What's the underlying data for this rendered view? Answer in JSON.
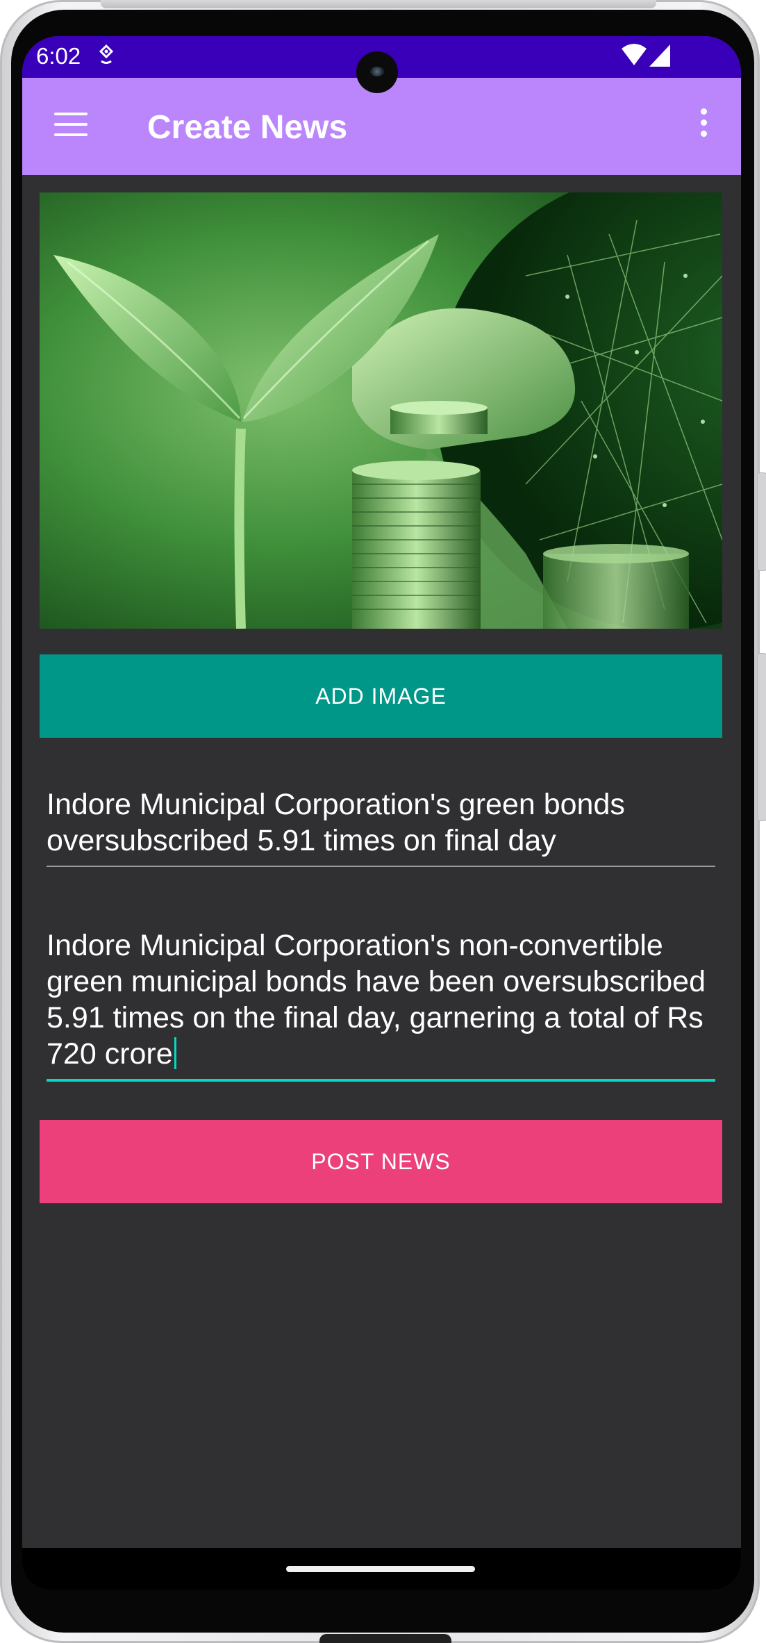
{
  "status_bar": {
    "time": "6:02",
    "background_color": "#3a00b9",
    "left_icons": [
      "location-icon"
    ],
    "right_icons": [
      "wifi-icon",
      "cell-signal-icon"
    ]
  },
  "app_bar": {
    "title": "Create News",
    "background_color": "#bb86fc",
    "left_icon": "menu-icon",
    "right_icon": "overflow-menu-icon"
  },
  "image": {
    "description_icon": "news-image",
    "accent_color": "#3f8f3a"
  },
  "buttons": {
    "add_image": "ADD IMAGE",
    "add_image_color": "#009688",
    "post_news": "POST NEWS",
    "post_news_color": "#ec407a"
  },
  "form": {
    "title_value": "Indore Municipal Corporation's green bonds oversubscribed 5.91 times on final day",
    "description_value": "Indore Municipal Corporation's non-convertible green municipal bonds have been oversubscribed 5.91 times on the final day, garnering a total of Rs 720 crore",
    "focus_color": "#03dac5"
  }
}
